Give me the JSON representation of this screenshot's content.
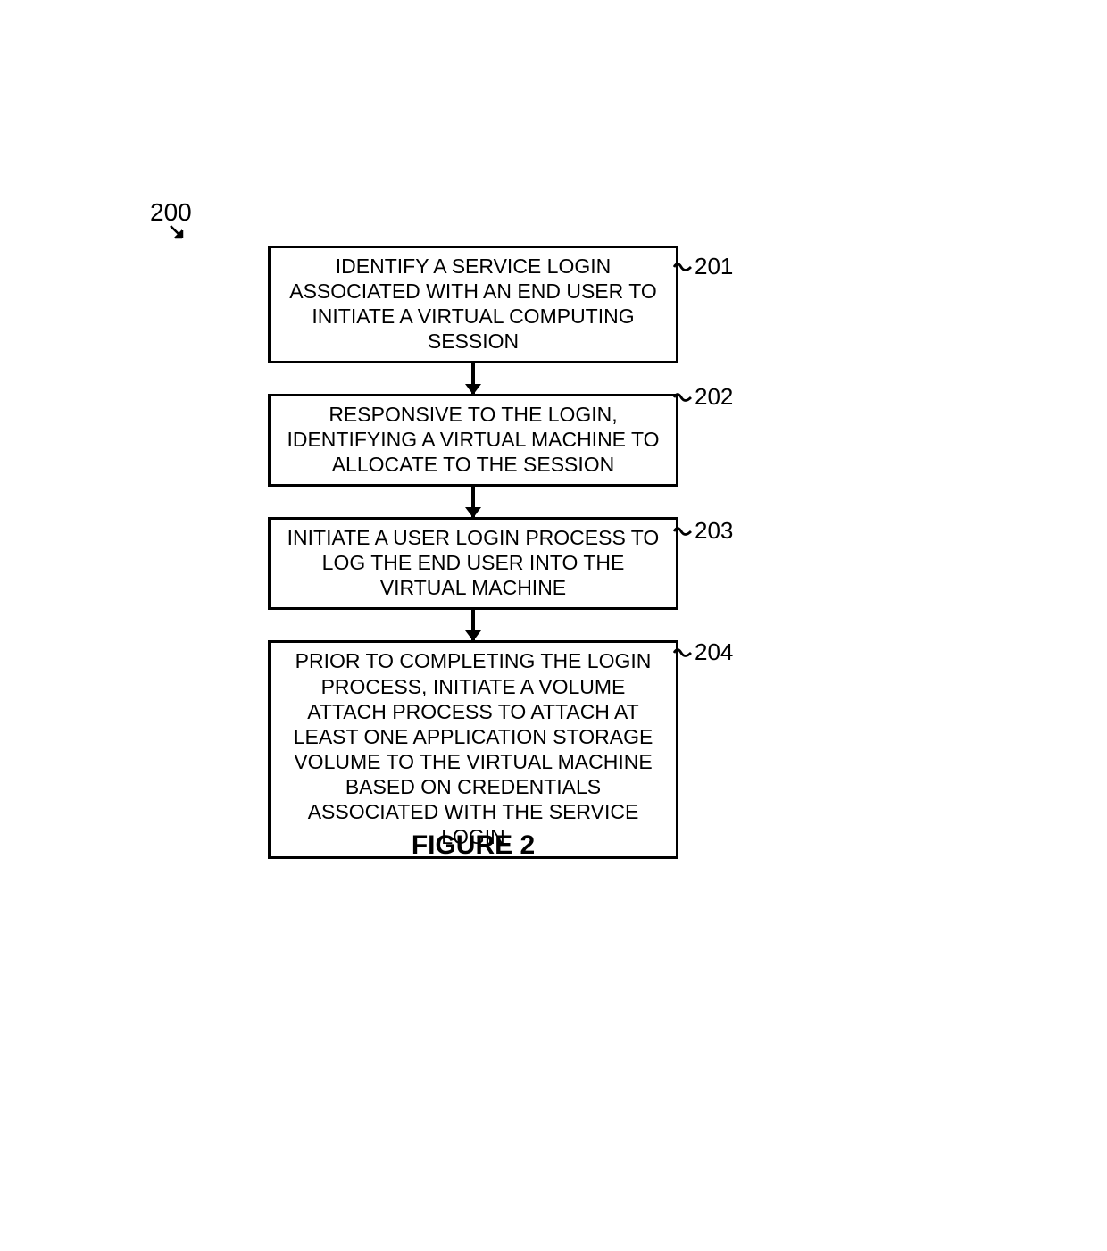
{
  "diagram": {
    "number": "200",
    "figure_label": "FIGURE 2",
    "steps": [
      {
        "id": "201",
        "text": "IDENTIFY A SERVICE LOGIN ASSOCIATED WITH AN END USER TO INITIATE A VIRTUAL COMPUTING SESSION"
      },
      {
        "id": "202",
        "text": "RESPONSIVE TO THE LOGIN, IDENTIFYING A VIRTUAL MACHINE TO ALLOCATE TO THE SESSION"
      },
      {
        "id": "203",
        "text": "INITIATE A USER LOGIN PROCESS TO LOG THE END USER INTO THE VIRTUAL MACHINE"
      },
      {
        "id": "204",
        "text": "PRIOR TO COMPLETING THE LOGIN PROCESS, INITIATE A VOLUME ATTACH PROCESS TO ATTACH AT LEAST ONE APPLICATION STORAGE VOLUME TO THE VIRTUAL MACHINE BASED ON CREDENTIALS ASSOCIATED WITH THE SERVICE LOGIN"
      }
    ]
  }
}
